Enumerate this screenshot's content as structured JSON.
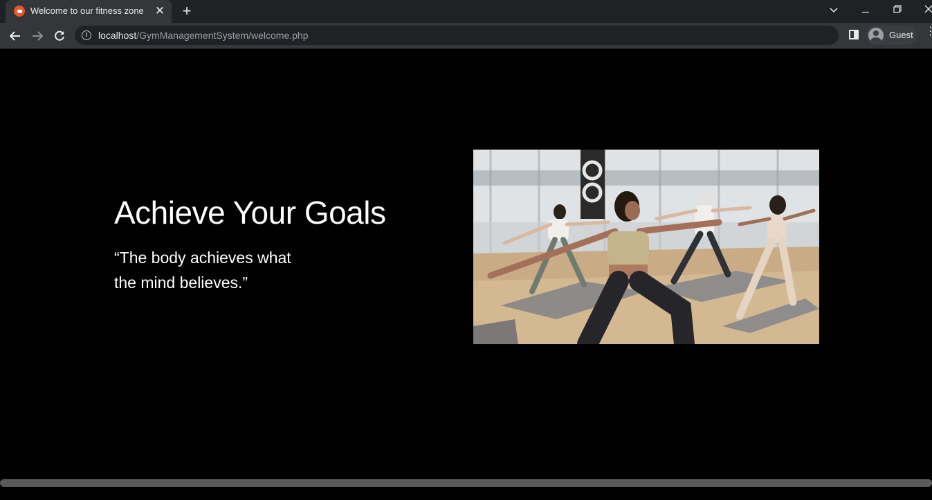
{
  "browser": {
    "tab": {
      "title": "Welcome to our fitness zone",
      "close_icon": "close-icon",
      "favicon": "gym-favicon-icon"
    },
    "new_tab_label": "+",
    "window_controls": [
      "chevron-down-icon",
      "minimize-icon",
      "restore-icon",
      "close-icon"
    ],
    "address": {
      "host": "localhost",
      "path": "/GymManagementSystem/welcome.php"
    },
    "profile_label": "Guest"
  },
  "hero": {
    "heading": "Achieve Your Goals",
    "quote_line1": "“The body achieves what",
    "quote_line2": "the mind believes.”",
    "image_subject": "yoga class warrior pose"
  },
  "colors": {
    "page_bg": "#000000",
    "chrome_dark": "#202124",
    "chrome_toolbar": "#35363a",
    "text": "#ffffff"
  }
}
